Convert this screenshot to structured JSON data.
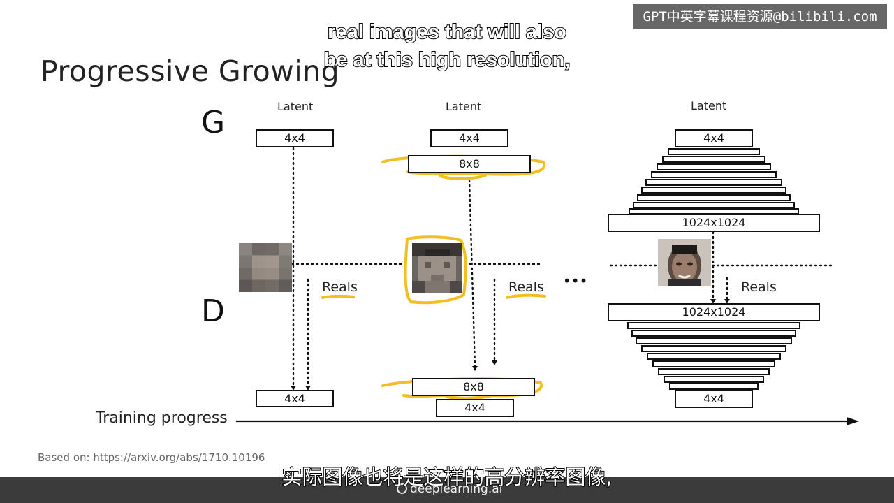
{
  "slide": {
    "title": "Progressive Growing",
    "generator_label": "G",
    "discriminator_label": "D",
    "training_progress_label": "Training progress",
    "citation": "Based on: https://arxiv.org/abs/1710.10196",
    "ellipsis": "•••"
  },
  "stages": [
    {
      "latent_label": "Latent",
      "g_top": "4x4",
      "reals_label": "Reals",
      "d_bottom": "4x4"
    },
    {
      "latent_label": "Latent",
      "g_top": "4x4",
      "g_mid": "8x8",
      "reals_label": "Reals",
      "d_top": "8x8",
      "d_bottom": "4x4"
    },
    {
      "latent_label": "Latent",
      "g_top": "4x4",
      "g_out": "1024x1024",
      "reals_label": "Reals",
      "d_in": "1024x1024",
      "d_bottom": "4x4"
    }
  ],
  "subtitles": {
    "english_line1": "real images that will also",
    "english_line2": "be at this high resolution,",
    "chinese": "实际图像也将是这样的高分辨率图像,"
  },
  "watermark": "GPT中英字幕课程资源@bilibili.com",
  "brand": "deeplearning.ai",
  "colors": {
    "highlight": "#F2BE22",
    "ink": "#111111"
  }
}
